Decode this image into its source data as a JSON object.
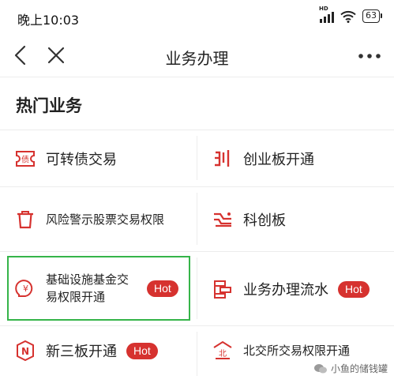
{
  "status": {
    "time": "晚上10:03",
    "network": "HD",
    "battery": "63"
  },
  "nav": {
    "title": "业务办理",
    "back_icon": "chevron-left-icon",
    "close_icon": "close-icon",
    "more_icon": "more-dots-icon"
  },
  "section": {
    "title": "热门业务"
  },
  "services": [
    {
      "label": "可转债交易",
      "icon": "convertible-bond-icon",
      "hot": ""
    },
    {
      "label": "创业板开通",
      "icon": "chinext-icon",
      "hot": ""
    },
    {
      "label": "风险警示股票交易权限",
      "icon": "trash-warning-icon",
      "hot": ""
    },
    {
      "label": "科创板",
      "icon": "star-market-icon",
      "hot": ""
    },
    {
      "label": "基础设施基金交易权限开通",
      "icon": "yuan-fund-icon",
      "hot": "Hot"
    },
    {
      "label": "业务办理流水",
      "icon": "business-flow-icon",
      "hot": "Hot"
    },
    {
      "label": "新三板开通",
      "icon": "neeq-icon",
      "hot": "Hot"
    },
    {
      "label": "北交所交易权限开通",
      "icon": "bse-icon",
      "hot": ""
    }
  ],
  "watermark": {
    "text": "小鱼的储钱罐"
  },
  "colors": {
    "accent_red": "#d6322f",
    "highlight_green": "#35b449",
    "divider": "#ececec"
  }
}
